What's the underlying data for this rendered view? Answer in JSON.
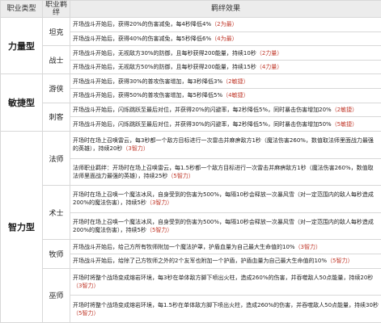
{
  "header": {
    "type": "职业类型",
    "job": "职业羁绊",
    "effect": "羁绊效果"
  },
  "groups": [
    {
      "type": "力量型",
      "jobs": [
        {
          "name": "坦克",
          "effects": [
            {
              "text": "开场战斗开始后，获得20%的伤害减免，每4秒降低4%",
              "level": "（2为最）"
            },
            {
              "text": "开场战斗开始后，获得40%的伤害减免，每5秒降低6%",
              "level": "（4为最）"
            }
          ]
        },
        {
          "name": "战士",
          "effects": [
            {
              "text": "开场战斗开始后，无视敌方30%的防御，且每秒获得200能量，持续10秒",
              "level": "（2力量）"
            },
            {
              "text": "开场战斗开始后，无视敌方50%的防御，且每秒获得200能量，持续15秒",
              "level": "（4力量）"
            }
          ]
        }
      ]
    },
    {
      "type": "敏捷型",
      "jobs": [
        {
          "name": "游侠",
          "effects": [
            {
              "text": "开场战斗开始后，获得30%的普攻伤害增加，每3秒降低3%",
              "level": "（2敏捷）"
            },
            {
              "text": "开场战斗开始后，获得50%的普攻伤害增加，每5秒降低5%",
              "level": "（4敏捷）"
            }
          ]
        },
        {
          "name": "刺客",
          "effects": [
            {
              "text": "开场战斗开始后，闪烁跳跃至最后对位，并获得20%的闪避率，每2秒降低5%，同时暴击伤害增加20%",
              "level": "（2敏捷）"
            },
            {
              "text": "开场战斗开始后，闪烁跳跃至最后对位，并获得30%的闪避率，每2秒降低5%，同时暴击伤害增加50%",
              "level": "（5敏捷）"
            }
          ]
        }
      ]
    },
    {
      "type": "智力型",
      "jobs": [
        {
          "name": "法师",
          "effects": [
            {
              "text": "开场时在场上召唤雷云，每3秒都一个敌方目标进行一次雷击并麻痹敌方1秒（魔法伤害260%，数值取法师里面战力最强的英雄），持续20秒",
              "level": "（3智力）"
            },
            {
              "text": "法师职业羁绊：开场时在场上召唤雷云，每1.5秒都一个敌方目标进行一次雷击并麻痹敌方1秒（魔法伤害260%，数值取法师里面战力最强的英雄），持续25秒",
              "level": "（5智力）"
            }
          ]
        },
        {
          "name": "术士",
          "effects": [
            {
              "text": "开场时在场上召唤一个魔法冰风，自身受到的伤害为500%，每隔10秒会释放一次暴风雪（对一定范围内的敌人每秒造成200%的魔法伤害），持续5秒",
              "level": "（3智力）"
            },
            {
              "text": "开场时在场上召唤一个魔法冰风，自身受到的伤害为500%，每隔10秒会释放一次暴风雪（对一定范围内的敌人每秒造成200%的魔法伤害），持续5秒",
              "level": "（5智力）"
            }
          ]
        },
        {
          "name": "牧师",
          "effects": [
            {
              "text": "开场战斗开始后，给己方所有牧师附加一个魔法护罩，护盾血量为自己最大生命值的10%",
              "level": "（3智力）"
            },
            {
              "text": "开场战斗开始后，给除了己方牧师之外的2个友军也附加一个护盾，护盾血量为自己最大生命值的10%",
              "level": "（5智力）"
            }
          ]
        },
        {
          "name": "巫师",
          "effects": [
            {
              "text": "开场时将整个战场变成熔岩环境，每3秒在单体敌方脚下喷出火柱，造成260%的伤害，并吞噬敌人50点能量，持续20秒",
              "level": "（3智力）"
            },
            {
              "text": "开场时将整个战场变成熔岩环境，每1.5秒在单体敌方脚下喷出火柱，造成260%的伤害，并吞噬敌人50点能量，持续30秒",
              "level": "（5智力）"
            }
          ]
        }
      ]
    }
  ]
}
